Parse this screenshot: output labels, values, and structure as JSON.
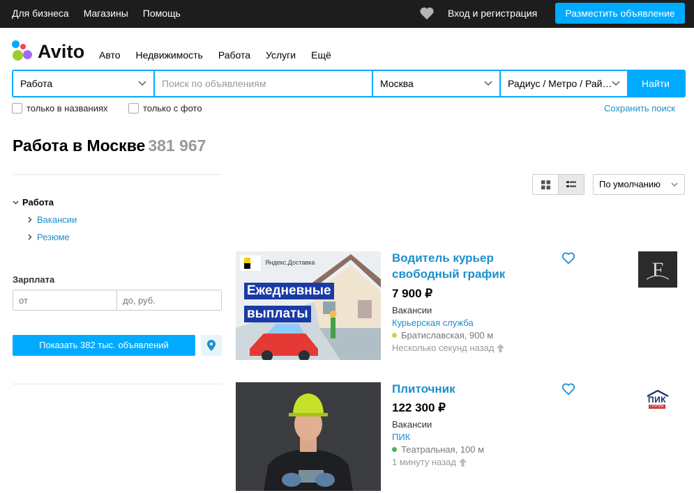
{
  "topbar": {
    "links": [
      "Для бизнеса",
      "Магазины",
      "Помощь"
    ],
    "login": "Вход и регистрация",
    "post_button": "Разместить объявление"
  },
  "logo": {
    "text": "Avito"
  },
  "nav": [
    "Авто",
    "Недвижимость",
    "Работа",
    "Услуги",
    "Ещё"
  ],
  "search": {
    "category": "Работа",
    "query_placeholder": "Поиск по объявлениям",
    "city": "Москва",
    "radius": "Радиус / Метро / Район",
    "find_button": "Найти"
  },
  "filters": {
    "titles_only": "только в названиях",
    "with_photo": "только с фото",
    "save_search": "Сохранить поиск"
  },
  "heading": {
    "title": "Работа в Москве",
    "count": "381 967"
  },
  "sidebar": {
    "root": "Работа",
    "items": [
      "Вакансии",
      "Резюме"
    ],
    "salary_label": "Зарплата",
    "salary_from_placeholder": "от",
    "salary_to_placeholder": "до, руб.",
    "show_button": "Показать 382 тыс. объявлений"
  },
  "sort": {
    "selected": "По умолчанию"
  },
  "listings": [
    {
      "title": "Водитель курьер свободный график",
      "price": "7 900 ₽",
      "category": "Вакансии",
      "company": "Курьерская служба",
      "metro": "Братиславская, 900 м",
      "metro_color": "#c8d63a",
      "time": "Несколько секунд назад",
      "ad_brand": "Яндекс.Доставка",
      "ad_line1": "Ежедневные",
      "ad_line2": "выплаты"
    },
    {
      "title": "Плиточник",
      "price": "122 300 ₽",
      "category": "Вакансии",
      "company": "ПИК",
      "metro": "Театральная, 100 м",
      "metro_color": "#4caf50",
      "time": "1 минуту назад",
      "seller_logo_text": "ПИК",
      "seller_logo_sub": "ГРУППА"
    }
  ],
  "colors": {
    "accent": "#00aaff",
    "link": "#1c8fcc",
    "topbar": "#1d1d1d"
  }
}
